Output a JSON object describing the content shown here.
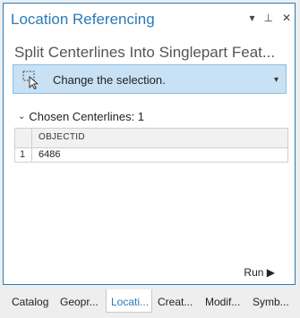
{
  "pane": {
    "title": "Location Referencing",
    "options_icon": "▾",
    "pin_icon": "⊥",
    "close_icon": "✕"
  },
  "tool": {
    "title": "Split Centerlines Into Singlepart Feat..."
  },
  "selection": {
    "label": "Change the selection.",
    "caret": "▾"
  },
  "section": {
    "label": "Chosen Centerlines: 1",
    "chevron": "⌄"
  },
  "grid": {
    "column": "OBJECTID",
    "rows": [
      {
        "num": "1",
        "value": "6486"
      }
    ]
  },
  "run_label": "Run ▶",
  "tabs": [
    "Catalog",
    "Geopr...",
    "Locati...",
    "Creat...",
    "Modif...",
    "Symb..."
  ],
  "active_tab": "Locati...",
  "colors": {
    "accent": "#2a7ab8",
    "selection_bg": "#c8e1f5"
  }
}
